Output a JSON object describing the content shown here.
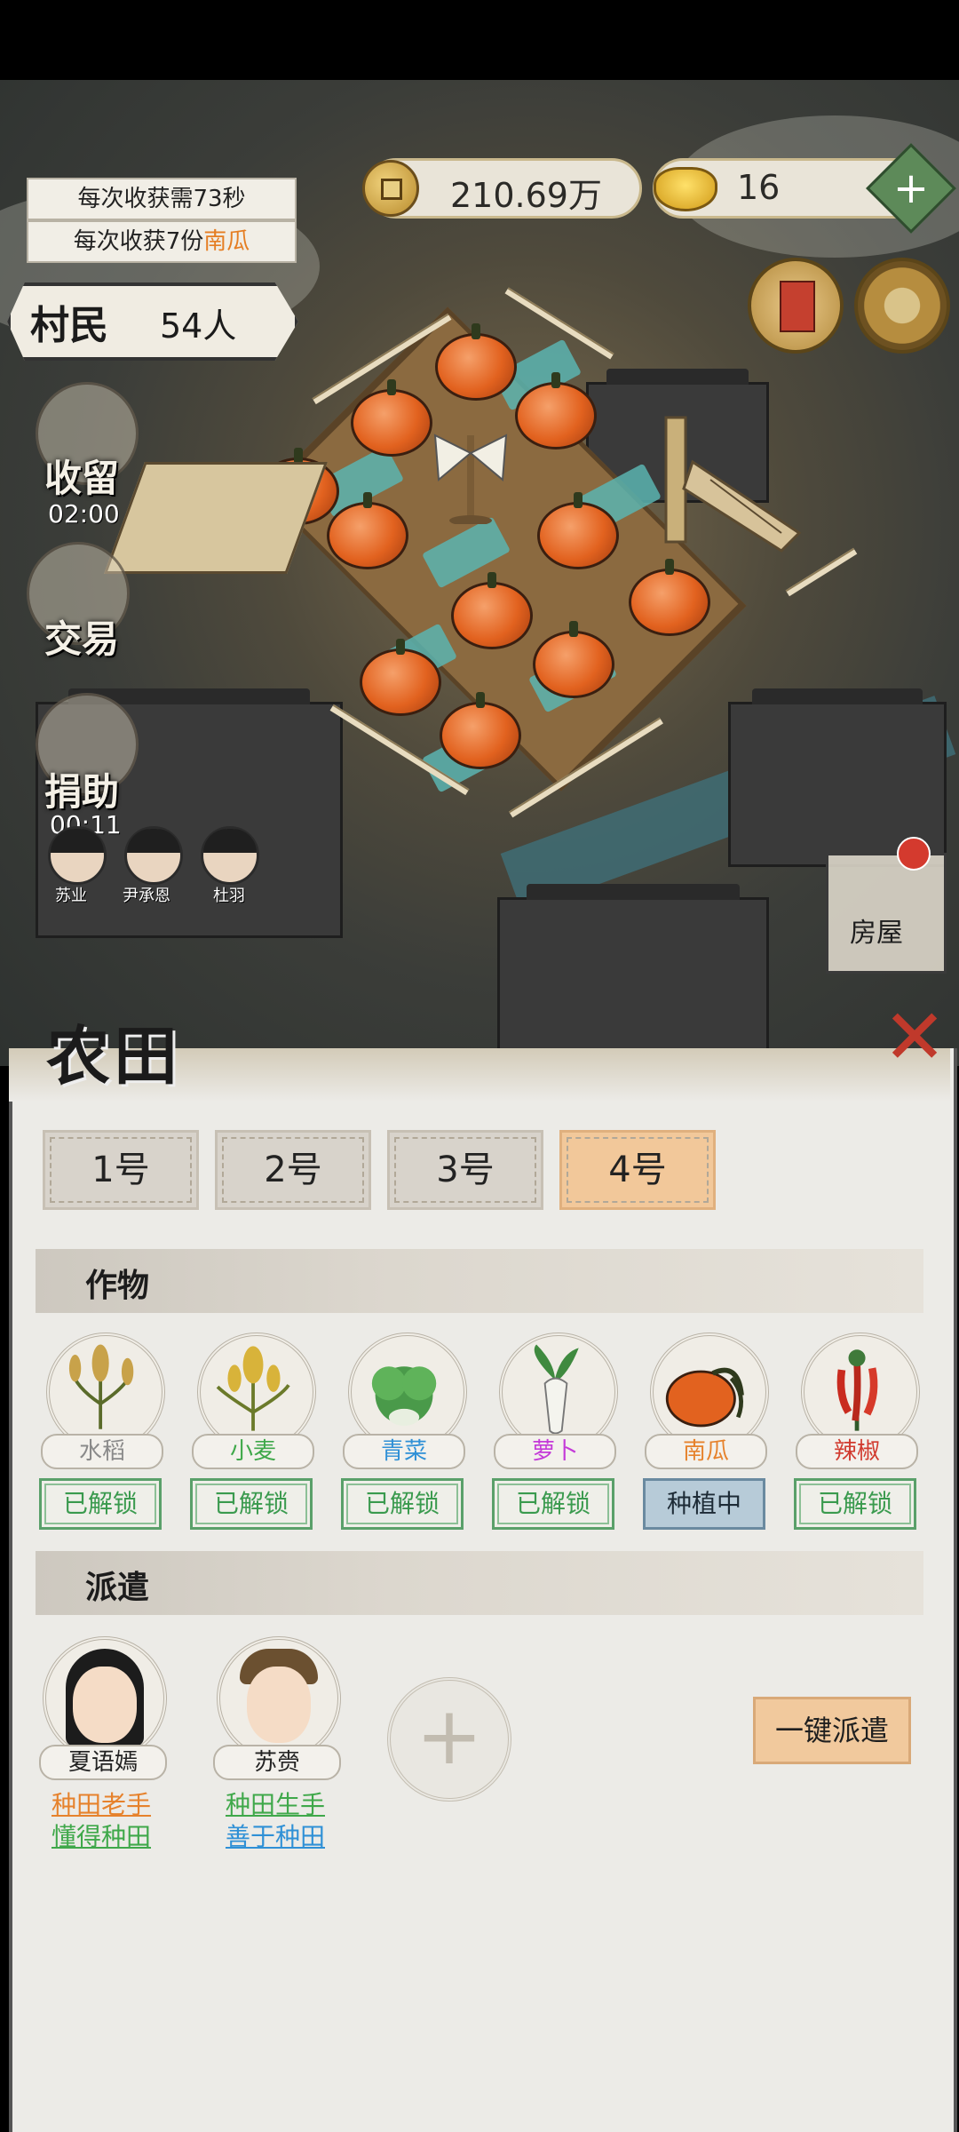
{
  "hud": {
    "coins": "210.69万",
    "gold": "16",
    "plus": "+",
    "tip_time": "每次收获需73秒",
    "tip_yield_prefix": "每次收获7份",
    "tip_yield_crop": "南瓜"
  },
  "villagers": {
    "label": "村民",
    "count": "54人"
  },
  "side_actions": {
    "shelter": {
      "label": "收留",
      "time": "02:00"
    },
    "trade": {
      "label": "交易"
    },
    "donate": {
      "label": "捐助",
      "time": "00:11"
    },
    "house": {
      "label": "房屋"
    }
  },
  "mini_people": [
    "苏业",
    "尹承恩",
    "杜羽"
  ],
  "panel": {
    "title": "农田",
    "close": "✕",
    "tabs": [
      "1号",
      "2号",
      "3号",
      "4号"
    ],
    "active_tab": 3,
    "crops_section": "作物",
    "dispatch_section": "派遣",
    "crops": [
      {
        "name": "水稻",
        "status": "已解锁",
        "color": "#8a8a8a"
      },
      {
        "name": "小麦",
        "status": "已解锁",
        "color": "#3fa84a"
      },
      {
        "name": "青菜",
        "status": "已解锁",
        "color": "#2f90d6"
      },
      {
        "name": "萝卜",
        "status": "已解锁",
        "color": "#c43ad8"
      },
      {
        "name": "南瓜",
        "status": "种植中",
        "color": "#e6822c"
      },
      {
        "name": "辣椒",
        "status": "已解锁",
        "color": "#d13b2f"
      }
    ],
    "workers": [
      {
        "name": "夏语嫣",
        "trait1": "种田老手",
        "trait2": "懂得种田",
        "trait1_color": "#e6822c",
        "trait2_color": "#3fa84a"
      },
      {
        "name": "苏赍",
        "trait1": "种田生手",
        "trait2": "善于种田",
        "trait1_color": "#3fa84a",
        "trait2_color": "#2f90d6"
      }
    ],
    "add_slot": "+",
    "one_key_dispatch": "一键派遣"
  }
}
